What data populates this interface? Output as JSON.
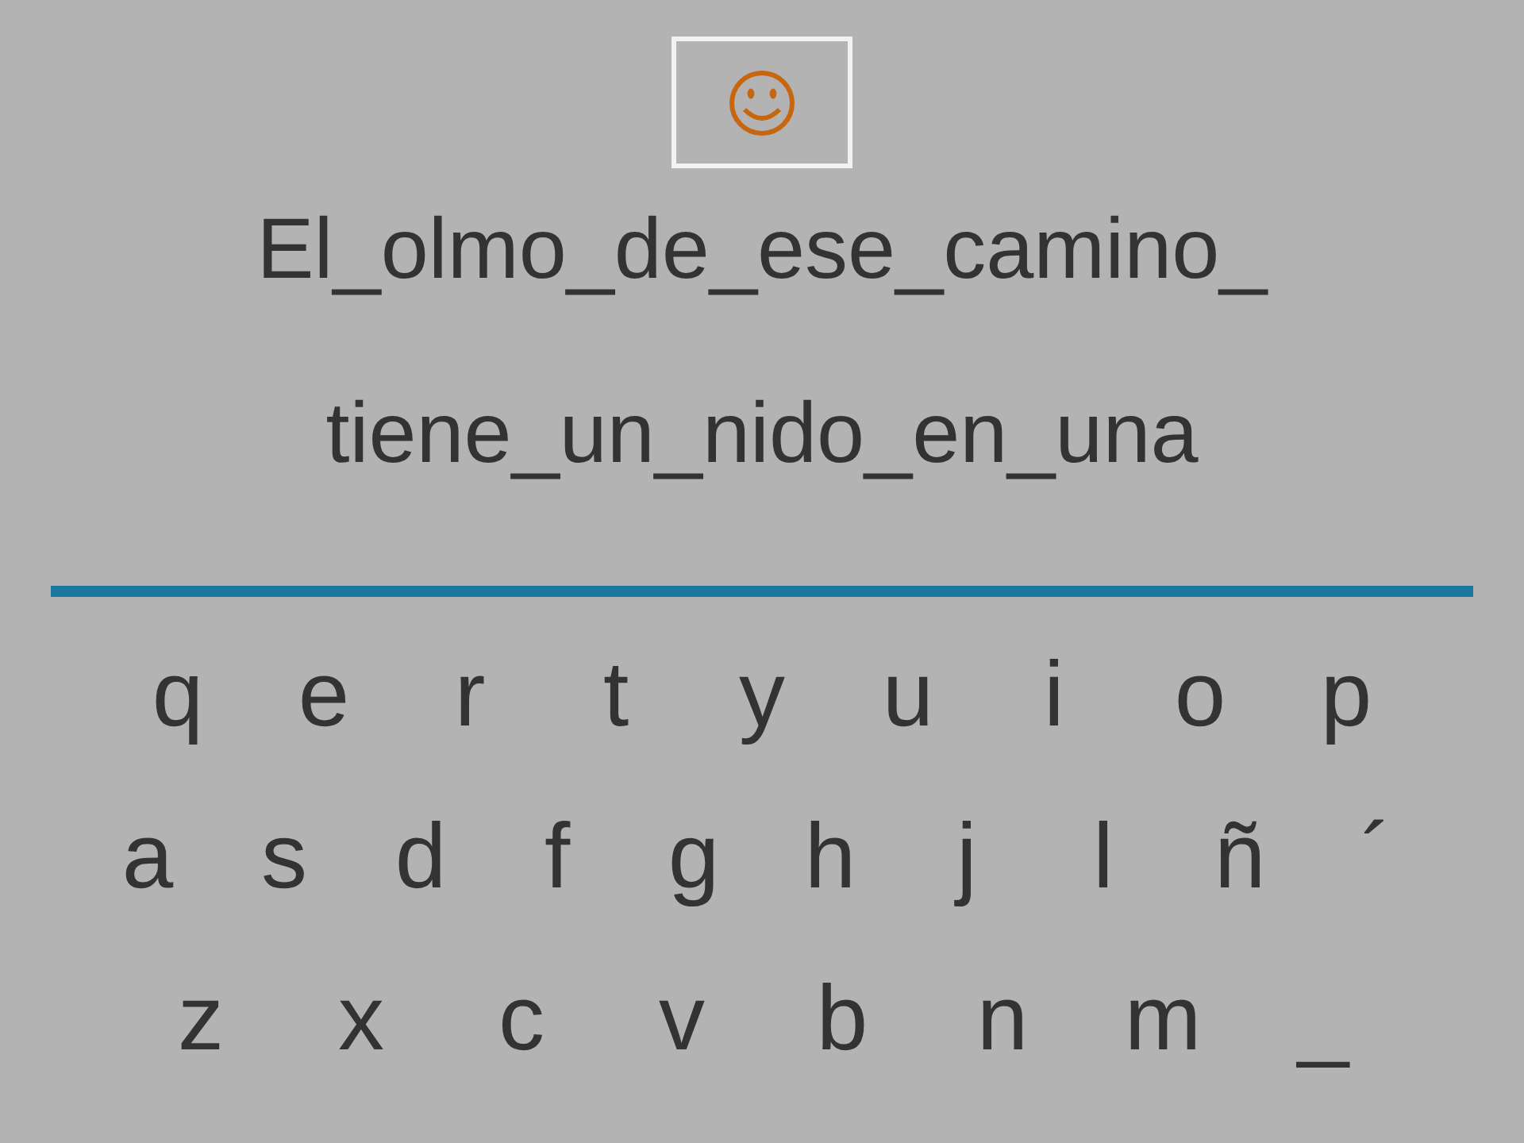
{
  "sentence_lines": [
    "El_olmo_de_ese_camino_",
    "tiene_un_nido_en_una"
  ],
  "keyboard_rows": [
    [
      "q",
      "e",
      "r",
      "t",
      "y",
      "u",
      "i",
      "o",
      "p"
    ],
    [
      "a",
      "s",
      "d",
      "f",
      "g",
      "h",
      "j",
      "l",
      "ñ",
      "´"
    ],
    [
      "z",
      "x",
      "c",
      "v",
      "b",
      "n",
      "m",
      "_"
    ]
  ]
}
